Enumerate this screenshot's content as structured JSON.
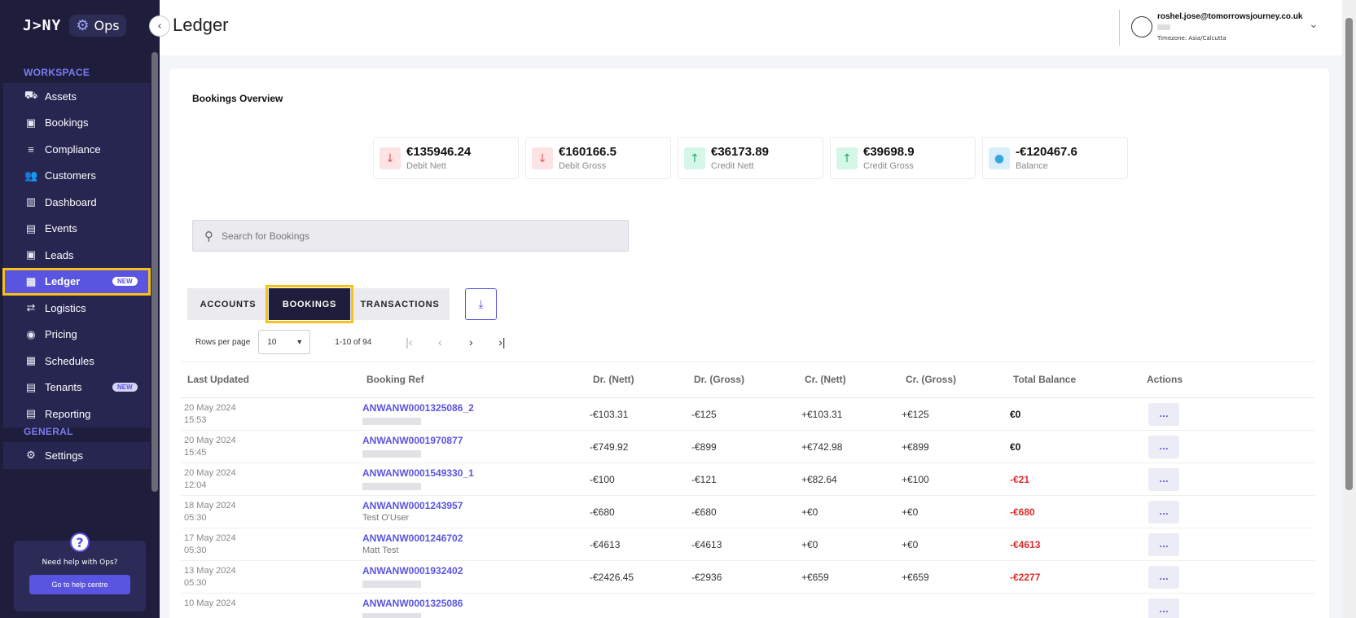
{
  "brand": {
    "logo": "J>NY",
    "product": "Ops"
  },
  "sidebar": {
    "workspace_title": "WORKSPACE",
    "items": [
      {
        "label": "Assets",
        "icon": "car-icon",
        "glyph": "⛟"
      },
      {
        "label": "Bookings",
        "icon": "calendar-icon",
        "glyph": "▣"
      },
      {
        "label": "Compliance",
        "icon": "checklist-icon",
        "glyph": "≡"
      },
      {
        "label": "Customers",
        "icon": "people-icon",
        "glyph": "👥"
      },
      {
        "label": "Dashboard",
        "icon": "chart-icon",
        "glyph": "▥"
      },
      {
        "label": "Events",
        "icon": "event-icon",
        "glyph": "▤"
      },
      {
        "label": "Leads",
        "icon": "contact-icon",
        "glyph": "▣"
      },
      {
        "label": "Ledger",
        "icon": "book-icon",
        "glyph": "▦",
        "badge": "NEW",
        "active": true
      },
      {
        "label": "Logistics",
        "icon": "arrows-icon",
        "glyph": "⇄"
      },
      {
        "label": "Pricing",
        "icon": "piggy-icon",
        "glyph": "◉"
      },
      {
        "label": "Schedules",
        "icon": "schedule-icon",
        "glyph": "▦"
      },
      {
        "label": "Tenants",
        "icon": "tenants-icon",
        "glyph": "▤",
        "badge": "NEW"
      },
      {
        "label": "Reporting",
        "icon": "report-icon",
        "glyph": "▤"
      }
    ],
    "general_title": "GENERAL",
    "general_items": [
      {
        "label": "Settings",
        "icon": "gear-icon",
        "glyph": "⚙"
      }
    ],
    "help": {
      "text": "Need help with Ops?",
      "button": "Go to help centre"
    }
  },
  "header": {
    "title": "Ledger",
    "user_email": "roshel.jose@tomorrowsjourney.co.uk",
    "timezone": "Timezone: Asia/Calcutta"
  },
  "overview": {
    "title": "Bookings Overview",
    "stats": [
      {
        "value": "€135946.24",
        "label": "Debit Nett",
        "kind": "down"
      },
      {
        "value": "€160166.5",
        "label": "Debit Gross",
        "kind": "down"
      },
      {
        "value": "€36173.89",
        "label": "Credit Nett",
        "kind": "up"
      },
      {
        "value": "€39698.9",
        "label": "Credit Gross",
        "kind": "up"
      },
      {
        "value": "-€120467.6",
        "label": "Balance",
        "kind": "bal"
      }
    ]
  },
  "search": {
    "placeholder": "Search for Bookings"
  },
  "tabs": [
    "ACCOUNTS",
    "BOOKINGS",
    "TRANSACTIONS"
  ],
  "pagination": {
    "rows_label": "Rows per page",
    "rows_value": "10",
    "range": "1-10 of 94"
  },
  "table": {
    "columns": [
      "Last Updated",
      "Booking Ref",
      "Dr. (Nett)",
      "Dr. (Gross)",
      "Cr. (Nett)",
      "Cr. (Gross)",
      "Total Balance",
      "Actions"
    ],
    "rows": [
      {
        "date": "20 May 2024",
        "time": "15:53",
        "ref": "ANWANW0001325086_2",
        "customer": "",
        "dr_nett": "-€103.31",
        "dr_gross": "-€125",
        "cr_nett": "+€103.31",
        "cr_gross": "+€125",
        "balance": "€0",
        "negative": false,
        "action": "..."
      },
      {
        "date": "20 May 2024",
        "time": "15:45",
        "ref": "ANWANW0001970877",
        "customer": "",
        "dr_nett": "-€749.92",
        "dr_gross": "-€899",
        "cr_nett": "+€742.98",
        "cr_gross": "+€899",
        "balance": "€0",
        "negative": false,
        "action": "..."
      },
      {
        "date": "20 May 2024",
        "time": "12:04",
        "ref": "ANWANW0001549330_1",
        "customer": "",
        "dr_nett": "-€100",
        "dr_gross": "-€121",
        "cr_nett": "+€82.64",
        "cr_gross": "+€100",
        "balance": "-€21",
        "negative": true,
        "action": "..."
      },
      {
        "date": "18 May 2024",
        "time": "05:30",
        "ref": "ANWANW0001243957",
        "customer": "Test O'User",
        "dr_nett": "-€680",
        "dr_gross": "-€680",
        "cr_nett": "+€0",
        "cr_gross": "+€0",
        "balance": "-€680",
        "negative": true,
        "action": "..."
      },
      {
        "date": "17 May 2024",
        "time": "05:30",
        "ref": "ANWANW0001246702",
        "customer": "Matt Test",
        "dr_nett": "-€4613",
        "dr_gross": "-€4613",
        "cr_nett": "+€0",
        "cr_gross": "+€0",
        "balance": "-€4613",
        "negative": true,
        "action": "..."
      },
      {
        "date": "13 May 2024",
        "time": "05:30",
        "ref": "ANWANW0001932402",
        "customer": "",
        "dr_nett": "-€2426.45",
        "dr_gross": "-€2936",
        "cr_nett": "+€659",
        "cr_gross": "+€659",
        "balance": "-€2277",
        "negative": true,
        "action": "..."
      },
      {
        "date": "10 May 2024",
        "time": "",
        "ref": "ANWANW0001325086",
        "customer": "",
        "dr_nett": "",
        "dr_gross": "",
        "cr_nett": "",
        "cr_gross": "",
        "balance": "",
        "negative": false,
        "action": "..."
      }
    ]
  }
}
